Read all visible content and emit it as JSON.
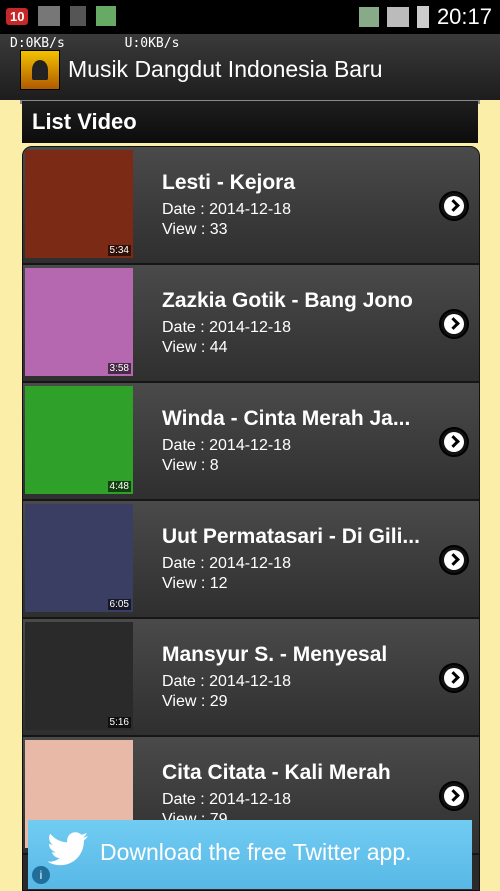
{
  "status_bar": {
    "notification_count": "10",
    "time": "20:17",
    "download_speed": "D:0KB/s",
    "upload_speed": "U:0KB/s"
  },
  "app": {
    "title": "Musik Dangdut Indonesia Baru"
  },
  "section": {
    "title": "List Video"
  },
  "videos": [
    {
      "title": "Lesti - Kejora",
      "date": "Date : 2014-12-18",
      "views": "View : 33",
      "duration": "5:34",
      "thumb_color": "#7a2a15"
    },
    {
      "title": "Zazkia Gotik - Bang Jono",
      "date": "Date : 2014-12-18",
      "views": "View : 44",
      "duration": "3:58",
      "thumb_color": "#b567b0"
    },
    {
      "title": "Winda - Cinta Merah Ja...",
      "date": "Date : 2014-12-18",
      "views": "View : 8",
      "duration": "4:48",
      "thumb_color": "#2fa02a"
    },
    {
      "title": "Uut Permatasari - Di Gili...",
      "date": "Date : 2014-12-18",
      "views": "View : 12",
      "duration": "6:05",
      "thumb_color": "#3a3e63"
    },
    {
      "title": "Mansyur S. - Menyesal",
      "date": "Date : 2014-12-18",
      "views": "View : 29",
      "duration": "5:16",
      "thumb_color": "#2a2a2a"
    },
    {
      "title": "Cita Citata - Kali Merah",
      "date": "Date : 2014-12-18",
      "views": "View : 79",
      "duration": "",
      "thumb_color": "#e8b9a6"
    }
  ],
  "ad": {
    "text": "Download the free Twitter app.",
    "info_label": "i"
  }
}
